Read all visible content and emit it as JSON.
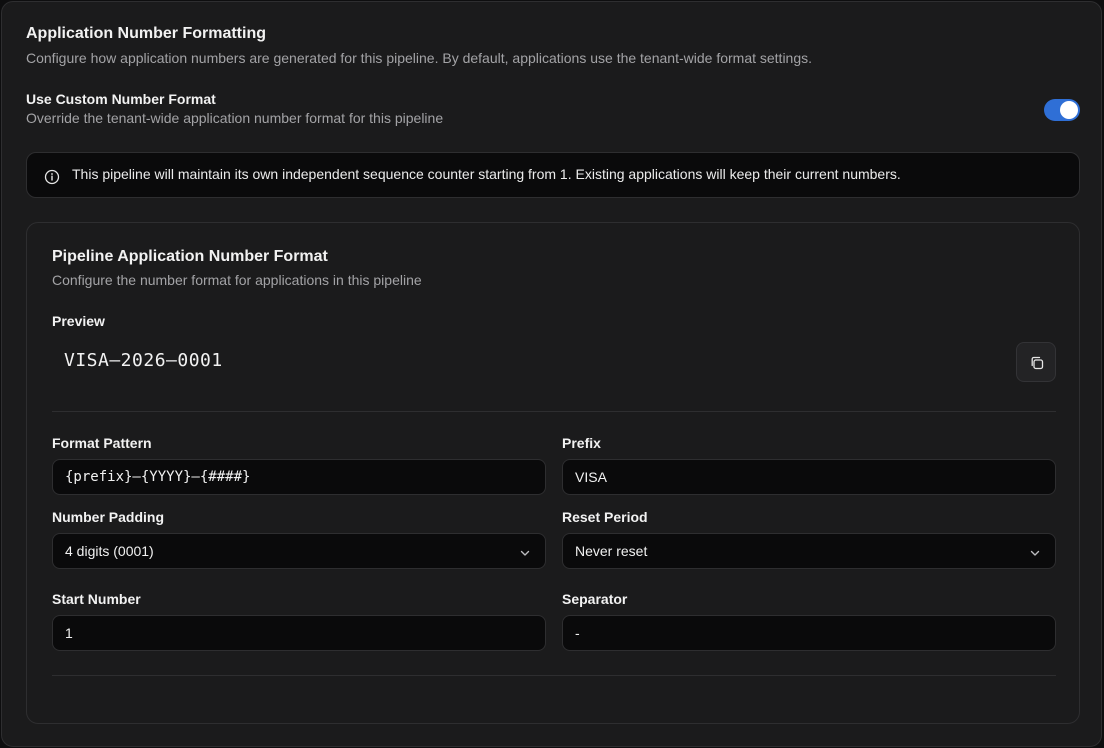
{
  "header": {
    "title": "Application Number Formatting",
    "description": "Configure how application numbers are generated for this pipeline. By default, applications use the tenant-wide format settings."
  },
  "custom_format": {
    "title": "Use Custom Number Format",
    "description": "Override the tenant-wide application number format for this pipeline",
    "enabled": true
  },
  "info": {
    "text": "This pipeline will maintain its own independent sequence counter starting from 1. Existing applications will keep their current numbers."
  },
  "card": {
    "title": "Pipeline Application Number Format",
    "description": "Configure the number format for applications in this pipeline",
    "preview_label": "Preview",
    "preview_value": "VISA–2026–0001"
  },
  "form": {
    "format_pattern": {
      "label": "Format Pattern",
      "value": "{prefix}–{YYYY}–{####}"
    },
    "prefix": {
      "label": "Prefix",
      "value": "VISA"
    },
    "number_padding": {
      "label": "Number Padding",
      "value": "4 digits (0001)"
    },
    "reset_period": {
      "label": "Reset Period",
      "value": "Never reset"
    },
    "start_number": {
      "label": "Start Number",
      "value": "1"
    },
    "separator": {
      "label": "Separator",
      "value": "-"
    }
  },
  "colors": {
    "toggle_on": "#2f6fd6",
    "panel_bg": "#1b1b1c",
    "input_bg": "#0a0a0b"
  },
  "icons": {
    "info": "info-circle-icon",
    "copy": "copy-icon",
    "chevron": "chevron-down-icon"
  }
}
